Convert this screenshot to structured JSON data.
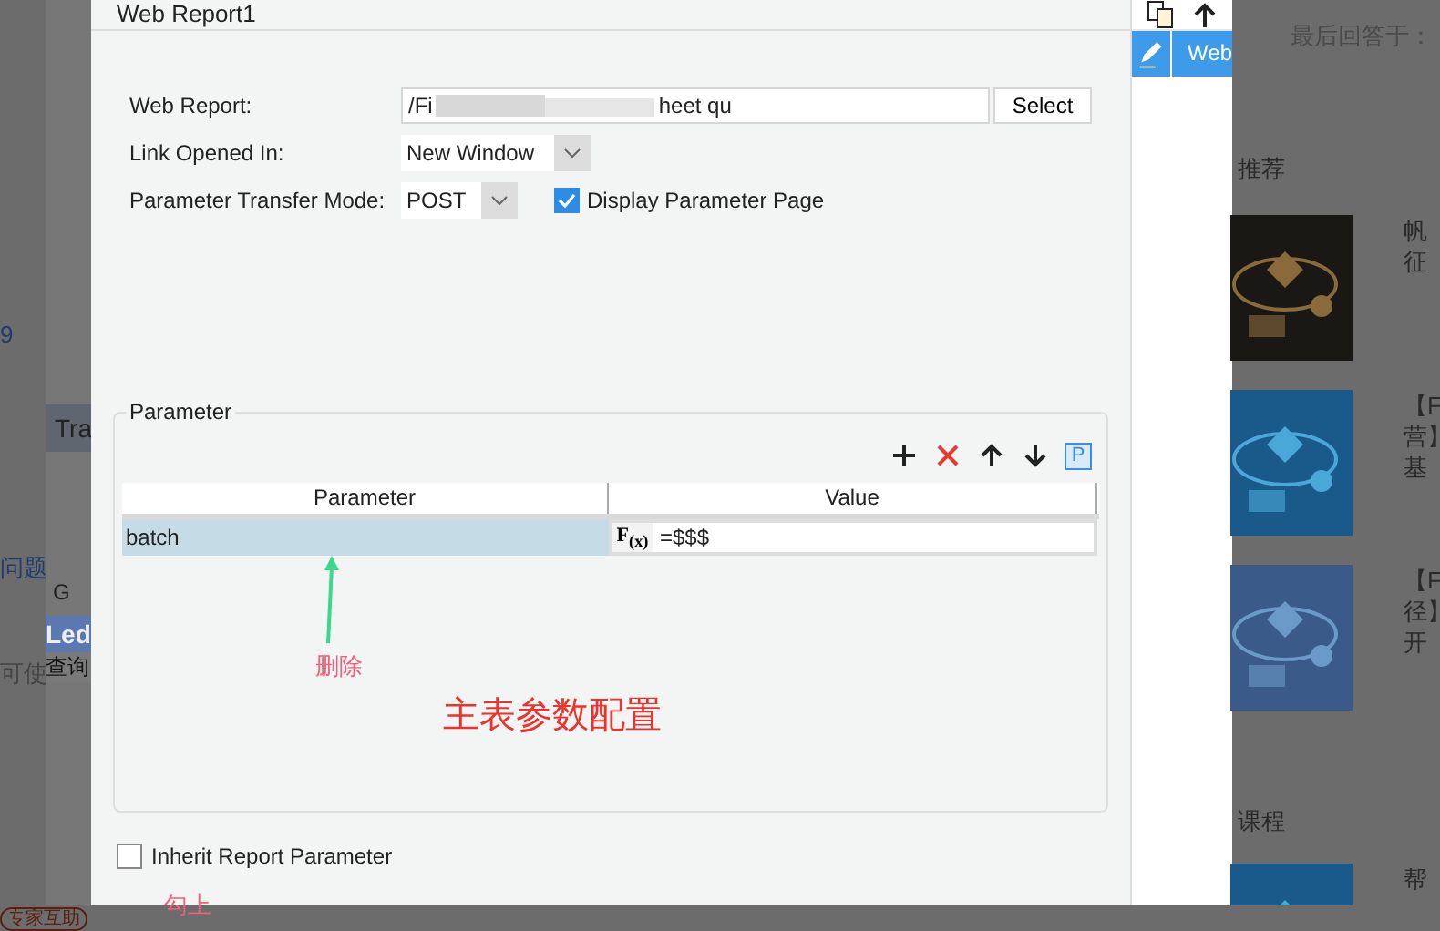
{
  "background_left": {
    "texts": [
      {
        "kind": "link",
        "text": "9"
      },
      {
        "kind": "link",
        "text": "问题"
      },
      {
        "kind": "plain",
        "text": "可使"
      }
    ],
    "badge": "专家互助"
  },
  "sheet": {
    "tab": "Tra",
    "column": "G",
    "cell_header": "Led",
    "cell": "查询"
  },
  "dialog": {
    "title": "Web Report1",
    "web_report": {
      "label": "Web Report:",
      "value_start": "/Fi",
      "value_end": "heet qu",
      "button": "Select"
    },
    "link_opened_in": {
      "label": "Link Opened In:",
      "value": "New Window"
    },
    "transfer_mode": {
      "label": "Parameter Transfer Mode:",
      "value": "POST"
    },
    "display_parameter_page": {
      "label": "Display Parameter Page",
      "checked": true
    },
    "parameter_group": {
      "title": "Parameter",
      "toolbar": [
        {
          "kind": "add"
        },
        {
          "kind": "delete"
        },
        {
          "kind": "up"
        },
        {
          "kind": "down"
        },
        {
          "kind": "p",
          "text": "P"
        }
      ],
      "columns": [
        "Parameter",
        "Value"
      ],
      "rows": [
        {
          "name": "batch",
          "formula": "F$_{(x)}$",
          "value": "=$$$",
          "selected": true
        }
      ]
    },
    "inherit_report_parameter": {
      "label": "Inherit Report Parameter",
      "checked": false
    },
    "annotations": {
      "arrow_note": "删除",
      "main_note": "主表参数配置",
      "check_note": "勾上"
    }
  },
  "tool_panel": {
    "items": [
      {
        "label": "Web",
        "selected": true
      }
    ]
  },
  "background_right": {
    "answered": "最后回答于：",
    "recommend": "推荐",
    "articles": [
      {
        "lines": [
          "帆",
          "征"
        ]
      },
      {
        "lines": [
          "【F",
          "营】",
          "基"
        ]
      },
      {
        "lines": [
          "【F",
          "径】",
          "开"
        ]
      }
    ],
    "courses": "课程",
    "course_item": "帮"
  }
}
